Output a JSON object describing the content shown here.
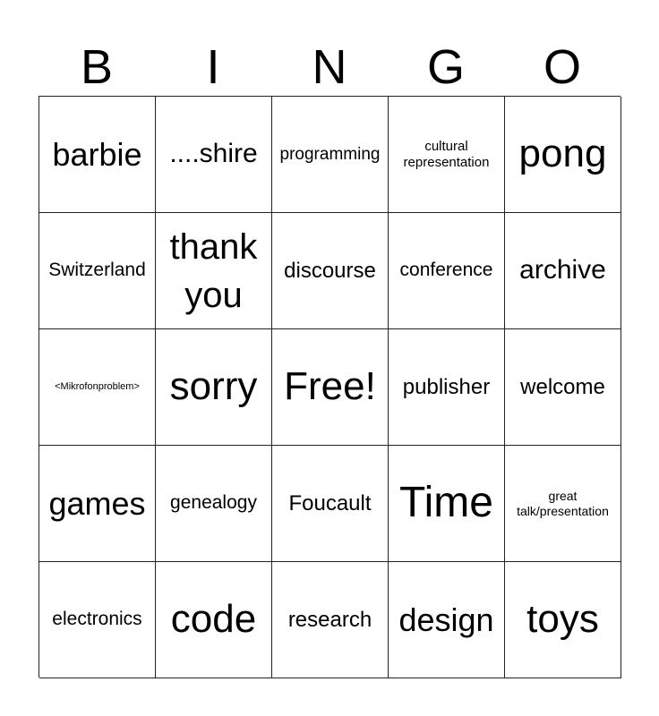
{
  "header": {
    "letters": [
      "B",
      "I",
      "N",
      "G",
      "O"
    ]
  },
  "cells": [
    {
      "text": "barbie",
      "size": "m"
    },
    {
      "text": "....shire",
      "size": "ms"
    },
    {
      "text": "programming",
      "size": "xxs"
    },
    {
      "text": "cultural representation",
      "size": "tt"
    },
    {
      "text": "pong",
      "size": "l"
    },
    {
      "text": "Switzerland",
      "size": "xs"
    },
    {
      "text": "thank you",
      "size": "ml"
    },
    {
      "text": "discourse",
      "size": "s"
    },
    {
      "text": "conference",
      "size": "xs"
    },
    {
      "text": "archive",
      "size": "ms"
    },
    {
      "text": "<Mikrofonproblem>",
      "size": "mini"
    },
    {
      "text": "sorry",
      "size": "l"
    },
    {
      "text": "Free!",
      "size": "l"
    },
    {
      "text": "publisher",
      "size": "s"
    },
    {
      "text": "welcome",
      "size": "s"
    },
    {
      "text": "games",
      "size": "m"
    },
    {
      "text": "genealogy",
      "size": "xs"
    },
    {
      "text": "Foucault",
      "size": "s"
    },
    {
      "text": "Time",
      "size": "xl"
    },
    {
      "text": "great talk/presentation",
      "size": "tt"
    },
    {
      "text": "electronics",
      "size": "xs"
    },
    {
      "text": "code",
      "size": "l"
    },
    {
      "text": "research",
      "size": "s"
    },
    {
      "text": "design",
      "size": "m"
    },
    {
      "text": "toys",
      "size": "l"
    }
  ]
}
